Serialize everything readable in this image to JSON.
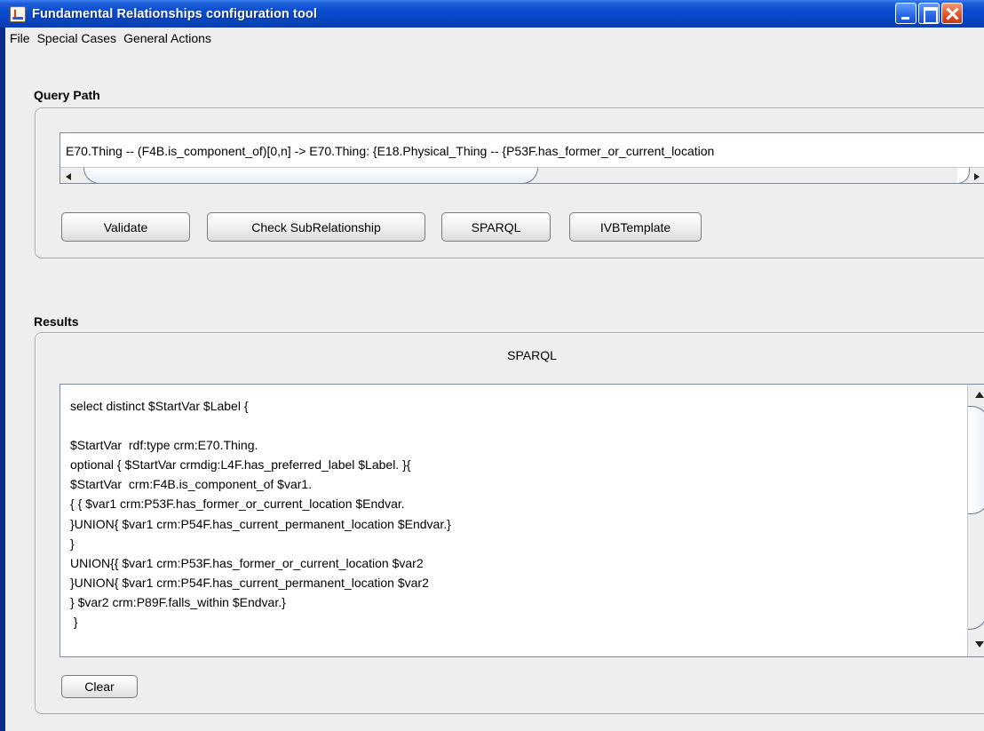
{
  "window": {
    "title": "Fundamental Relationships configuration tool"
  },
  "menu": [
    "File",
    "Special Cases",
    "General Actions"
  ],
  "query_path": {
    "title": "Query Path",
    "value": "E70.Thing  -- (F4B.is_component_of)[0,n]  -> E70.Thing: {E18.Physical_Thing -- {P53F.has_former_or_current_location"
  },
  "buttons": {
    "validate": "Validate",
    "check_sub": "Check SubRelationship",
    "sparql": "SPARQL",
    "ivb": "IVBTemplate",
    "clear": "Clear"
  },
  "results": {
    "title": "Results",
    "heading": "SPARQL",
    "text": "select distinct $StartVar $Label {\n\n$StartVar  rdf:type crm:E70.Thing.\noptional { $StartVar crmdig:L4F.has_preferred_label $Label. }{\n$StartVar  crm:F4B.is_component_of $var1.\n{ { $var1 crm:P53F.has_former_or_current_location $Endvar.\n}UNION{ $var1 crm:P54F.has_current_permanent_location $Endvar.}\n}\nUNION{{ $var1 crm:P53F.has_former_or_current_location $var2\n}UNION{ $var1 crm:P54F.has_current_permanent_location $var2\n} $var2 crm:P89F.falls_within $Endvar.}\n }"
  },
  "colors": {
    "titlebar": "#0a4cd0",
    "panel_bg": "#eeeeee",
    "close_button": "#e2562c"
  }
}
